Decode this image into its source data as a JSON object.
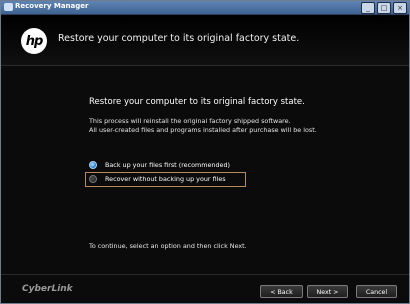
{
  "window": {
    "title": "Recovery Manager",
    "buttons": [
      "minimize",
      "maximize",
      "close"
    ]
  },
  "header": {
    "logo_text": "hp",
    "title": "Restore your computer to its original factory state."
  },
  "main": {
    "title": "Restore your computer to its original factory state.",
    "desc_line1": "This process will reinstall the original factory shipped software.",
    "desc_line2": "All user-created files and programs installed after purchase will be lost.",
    "options": [
      {
        "label": "Back up your files first (recommended)",
        "selected": true
      },
      {
        "label": "Recover without backing up your files",
        "selected": false
      }
    ],
    "instruction": "To continue, select an option and then click Next."
  },
  "footer": {
    "brand": "CyberLink",
    "back_label": "< Back",
    "next_label": "Next >",
    "cancel_label": "Cancel"
  }
}
